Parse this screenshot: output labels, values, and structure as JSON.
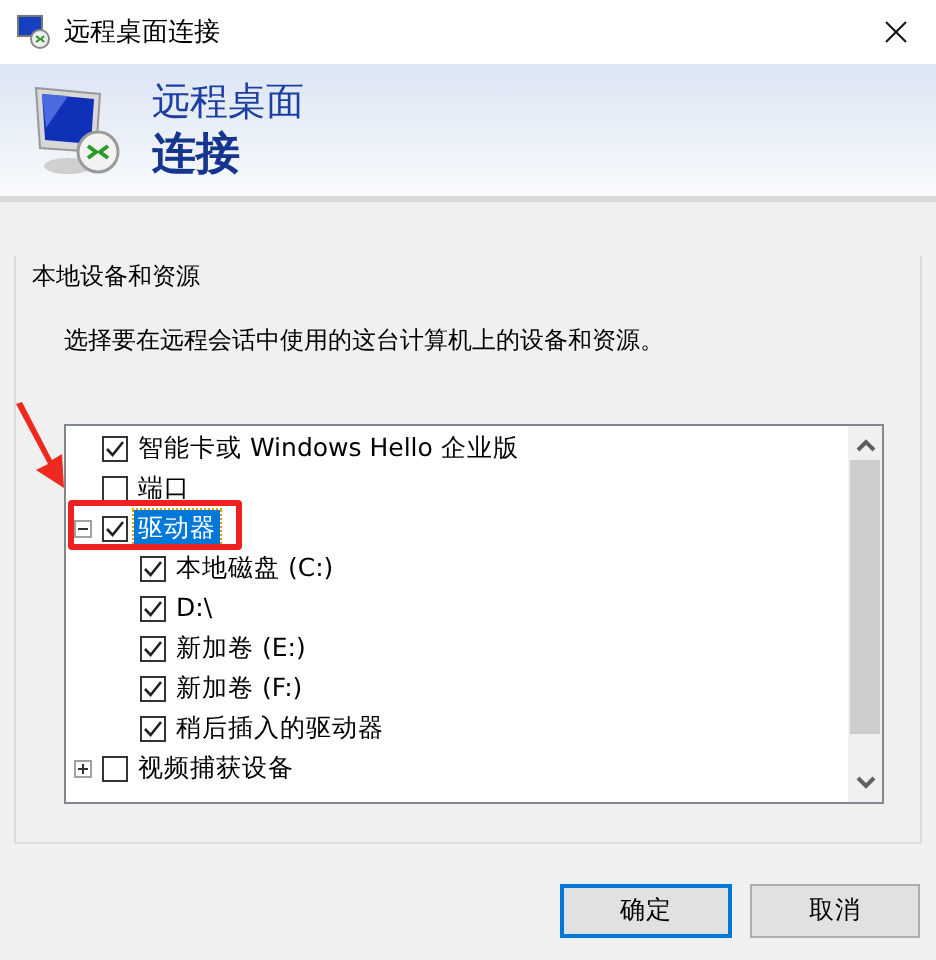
{
  "window": {
    "title": "远程桌面连接"
  },
  "header": {
    "line_1": "远程桌面",
    "line_2": "连接"
  },
  "group": {
    "title": "本地设备和资源",
    "description": "选择要在远程会话中使用的这台计算机上的设备和资源。"
  },
  "tree": [
    {
      "label": "智能卡或 Windows Hello 企业版",
      "checked": true,
      "selected": false
    },
    {
      "label": "端口",
      "checked": false,
      "selected": false
    },
    {
      "label": "驱动器",
      "checked": true,
      "selected": true,
      "expanded": true,
      "highlighted": true,
      "children": [
        {
          "label": "本地磁盘 (C:)",
          "checked": true,
          "selected": false
        },
        {
          "label": "D:\\",
          "checked": true,
          "selected": false
        },
        {
          "label": "新加卷 (E:)",
          "checked": true,
          "selected": false
        },
        {
          "label": "新加卷 (F:)",
          "checked": true,
          "selected": false
        },
        {
          "label": "稍后插入的驱动器",
          "checked": true,
          "selected": false
        }
      ]
    },
    {
      "label": "视频捕获设备",
      "checked": false,
      "selected": false,
      "expanded": false
    }
  ],
  "buttons": [
    {
      "label": "确定",
      "default": true
    },
    {
      "label": "取消",
      "default": false
    }
  ]
}
